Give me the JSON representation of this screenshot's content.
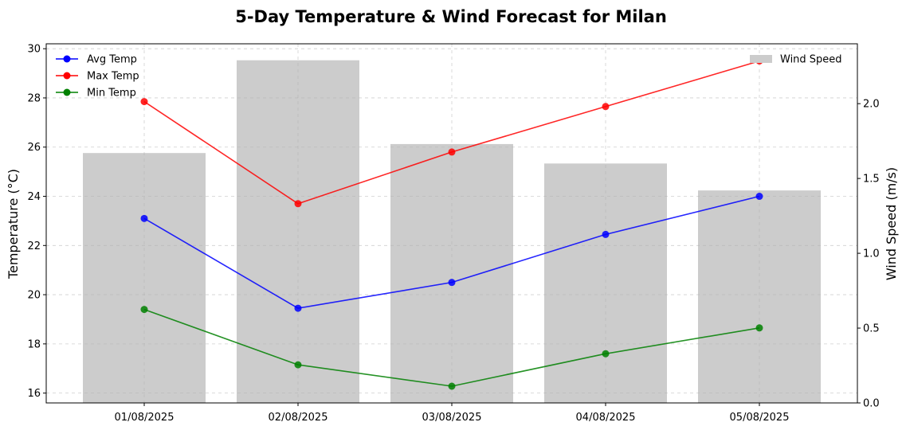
{
  "chart_data": {
    "type": "line",
    "title": "5-Day Temperature & Wind Forecast for Milan",
    "categories": [
      "01/08/2025",
      "02/08/2025",
      "03/08/2025",
      "04/08/2025",
      "05/08/2025"
    ],
    "ylabel": "Temperature (°C)",
    "ylabel_right": "Wind Speed (m/s)",
    "ylim": [
      15.6,
      30.2
    ],
    "ylim_right": [
      0,
      2.4
    ],
    "yticks": [
      16,
      18,
      20,
      22,
      24,
      26,
      28,
      30
    ],
    "yticks_right": [
      0.0,
      0.5,
      1.0,
      1.5,
      2.0
    ],
    "grid": true,
    "legend_left": "top-left",
    "legend_right": "top-right",
    "series": [
      {
        "name": "Avg Temp",
        "type": "line",
        "axis": "left",
        "color": "#0000ff",
        "values": [
          23.1,
          19.45,
          20.5,
          22.45,
          24.0
        ]
      },
      {
        "name": "Max Temp",
        "type": "line",
        "axis": "left",
        "color": "#ff0000",
        "values": [
          27.85,
          23.7,
          25.8,
          27.65,
          29.5
        ]
      },
      {
        "name": "Min Temp",
        "type": "line",
        "axis": "left",
        "color": "#008000",
        "values": [
          19.4,
          17.15,
          16.28,
          17.6,
          18.65
        ]
      },
      {
        "name": "Wind Speed",
        "type": "bar",
        "axis": "right",
        "color": "#cccccc",
        "values": [
          1.67,
          2.29,
          1.73,
          1.6,
          1.42
        ]
      }
    ]
  }
}
